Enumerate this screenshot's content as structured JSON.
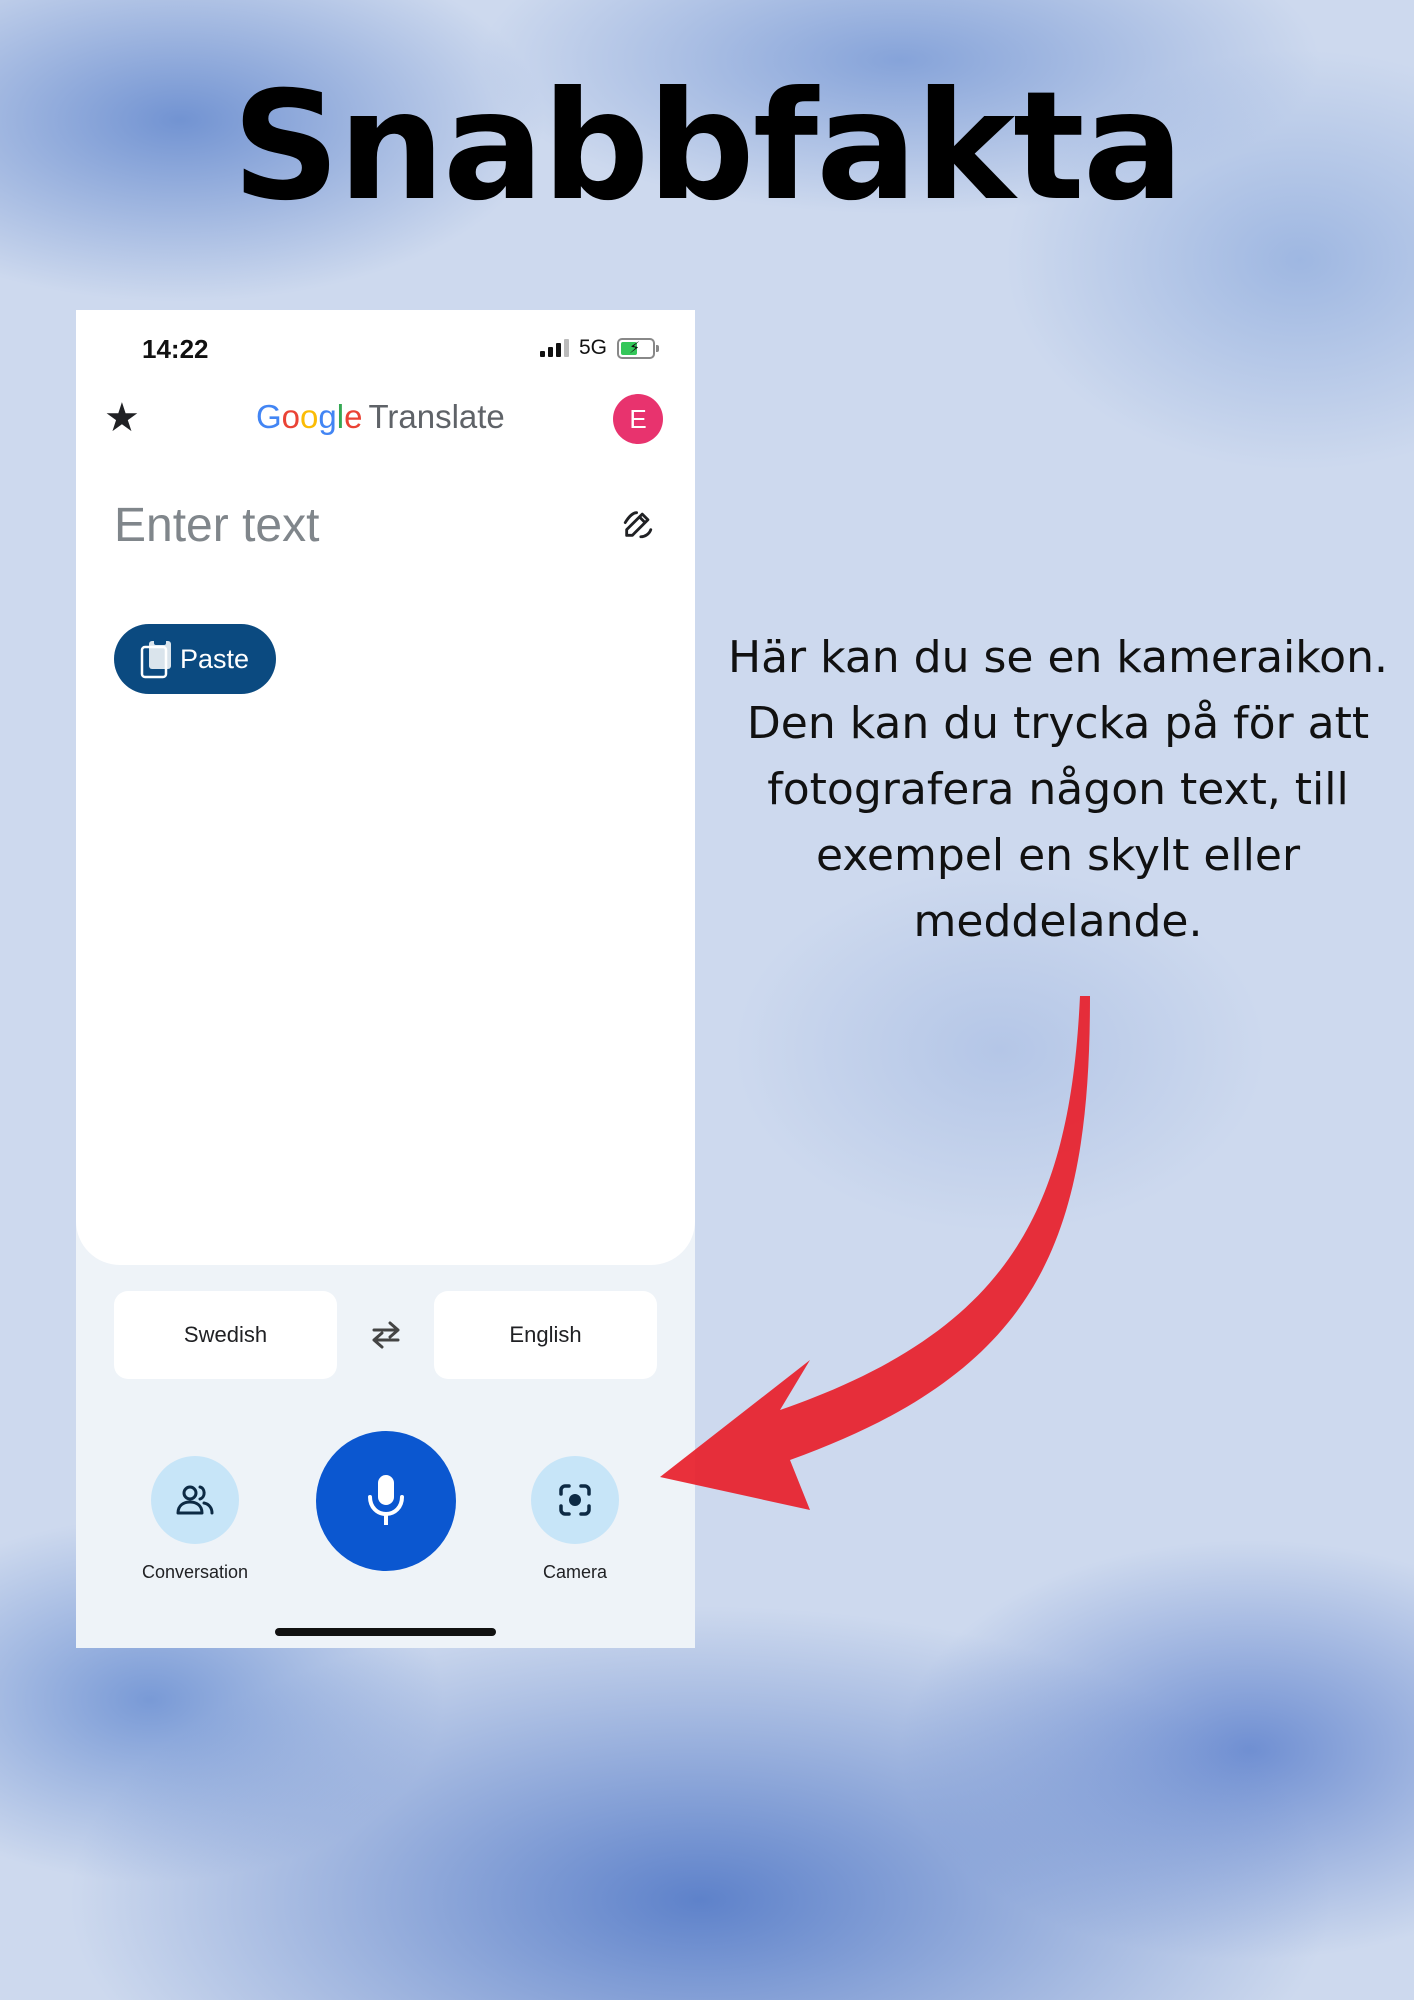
{
  "page": {
    "title": "Snabbfakta",
    "caption": "Här kan du se en  kameraikon. Den kan du trycka på för att fotografera någon text, till exempel en skylt eller meddelande."
  },
  "phone": {
    "status_bar": {
      "time": "14:22",
      "network": "5G",
      "icons": [
        "signal-icon",
        "battery-charging-icon"
      ]
    },
    "header": {
      "brand_google": [
        "G",
        "o",
        "o",
        "g",
        "l",
        "e"
      ],
      "brand_product": "Translate",
      "avatar_letter": "E",
      "icons": [
        "star-icon"
      ]
    },
    "input": {
      "placeholder": "Enter text",
      "icons": [
        "handwriting-icon"
      ]
    },
    "paste_button": {
      "label": "Paste",
      "icon": "clipboard-icon"
    },
    "languages": {
      "source": "Swedish",
      "target": "English",
      "swap_icon": "swap-arrows-icon"
    },
    "actions": {
      "conversation_label": "Conversation",
      "camera_label": "Camera",
      "icons": [
        "people-icon",
        "microphone-icon",
        "camera-lens-icon"
      ]
    }
  },
  "colors": {
    "accent_blue": "#0b57d0",
    "paste_blue": "#0b4a80",
    "avatar_pink": "#e8336e",
    "round_button": "#c7e5f8",
    "arrow_red": "#e8202a"
  }
}
